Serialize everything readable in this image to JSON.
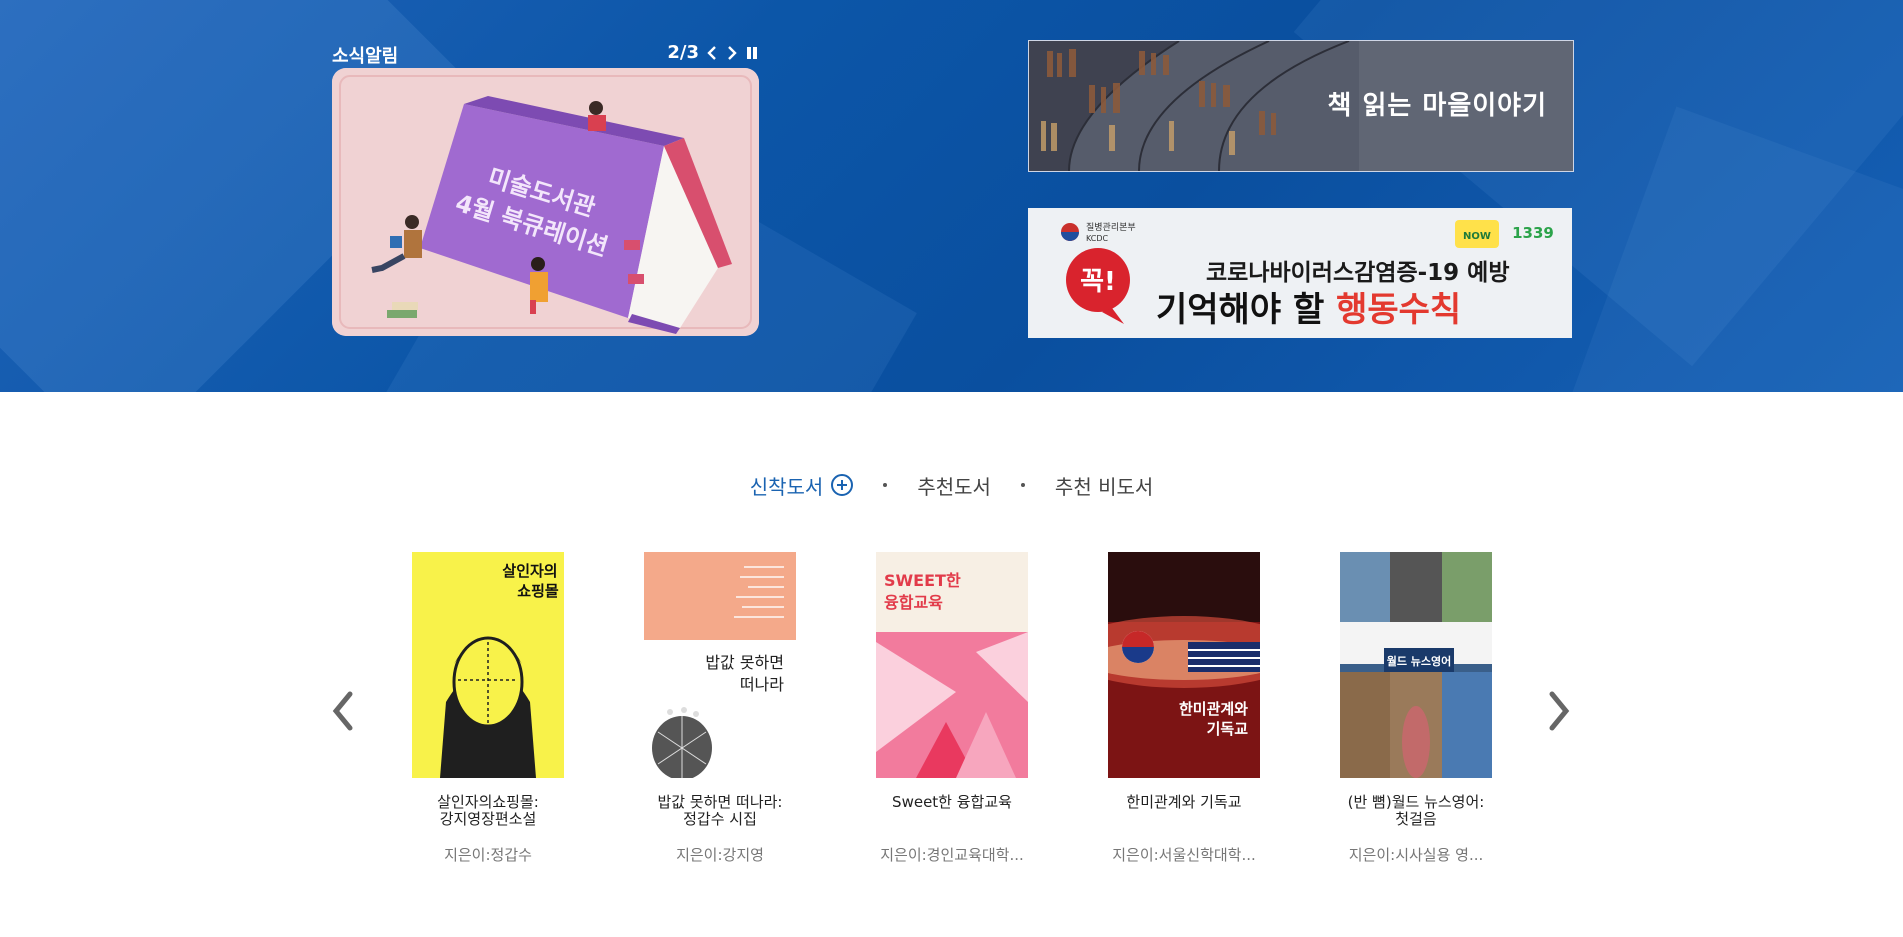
{
  "notice": {
    "title": "소식알림",
    "counter": "2/3",
    "card_line1": "미술도서관",
    "card_line2": "4월 북큐레이션"
  },
  "banners": [
    {
      "text": "책 읽는 마을이야기"
    },
    {
      "agency": "질병관리본부",
      "agency_en": "KCDC",
      "badge": "꼭!",
      "line1": "코로나바이러스감염증-19 예방",
      "line2_a": "기억해야 할 ",
      "line2_b": "행동수칙",
      "hotline": "1339"
    }
  ],
  "tabs": [
    {
      "label": "신착도서",
      "active": true
    },
    {
      "label": "추천도서",
      "active": false
    },
    {
      "label": "추천 비도서",
      "active": false
    }
  ],
  "books": [
    {
      "title": "살인자의쇼핑몰:\n강지영장편소설",
      "author": "지은이:정갑수",
      "cover_text": "살인자의\n쇼핑몰"
    },
    {
      "title": "밥값 못하면 떠나라:\n정갑수 시집",
      "author": "지은이:강지영",
      "cover_text": "밥값 못하면\n떠나라"
    },
    {
      "title": "Sweet한 융합교육",
      "author": "지은이:경인교육대학...",
      "cover_text": "SWEET한\n융합교육"
    },
    {
      "title": "한미관계와 기독교",
      "author": "지은이:서울신학대학...",
      "cover_text": "한미관계와\n기독교"
    },
    {
      "title": "(반 뼘)월드 뉴스영어:\n첫걸음",
      "author": "지은이:시사실용 영...",
      "cover_text": "월드 뉴스영어"
    }
  ]
}
